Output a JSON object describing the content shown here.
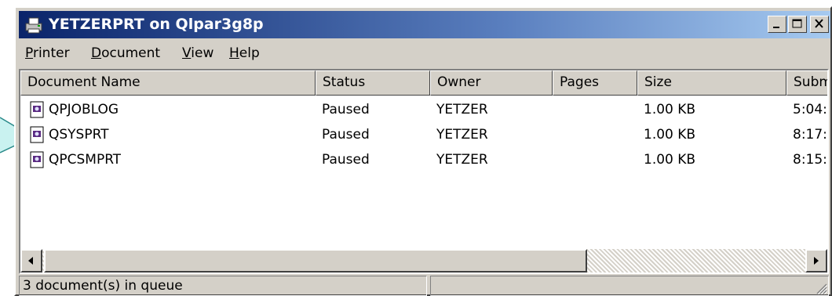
{
  "window": {
    "title": "YETZERPRT on Qlpar3g8p",
    "icon": "printer-icon",
    "controls": [
      "minimize",
      "maximize",
      "close"
    ]
  },
  "menu": [
    {
      "label": "Printer",
      "accel": "P",
      "rest": "rinter"
    },
    {
      "label": "Document",
      "accel": "D",
      "rest": "ocument"
    },
    {
      "label": "View",
      "accel": "V",
      "rest": "iew"
    },
    {
      "label": "Help",
      "accel": "H",
      "rest": "elp"
    }
  ],
  "columns": [
    "Document Name",
    "Status",
    "Owner",
    "Pages",
    "Size",
    "Subm"
  ],
  "rows": [
    {
      "name": "QPJOBLOG",
      "status": "Paused",
      "owner": "YETZER",
      "pages": "",
      "size": "1.00 KB",
      "submitted": "5:04:"
    },
    {
      "name": "QSYSPRT",
      "status": "Paused",
      "owner": "YETZER",
      "pages": "",
      "size": "1.00 KB",
      "submitted": "8:17:"
    },
    {
      "name": "QPCSMPRT",
      "status": "Paused",
      "owner": "YETZER",
      "pages": "",
      "size": "1.00 KB",
      "submitted": "8:15:"
    }
  ],
  "status": {
    "queue_text": "3 document(s) in queue",
    "second_pane": ""
  },
  "colors": {
    "title_start": "#0a246a",
    "title_end": "#a6caf0",
    "face": "#d4d0c8",
    "callout": "#c9f2f0"
  }
}
